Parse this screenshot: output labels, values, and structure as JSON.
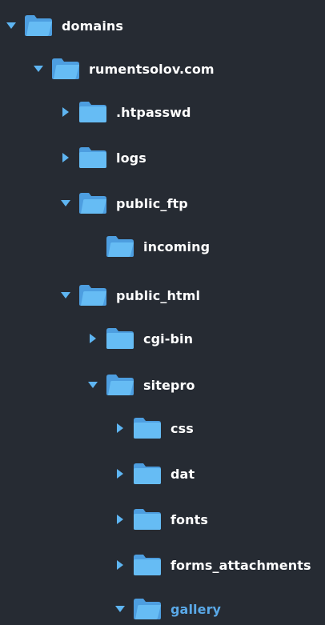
{
  "accent_color": "#5aa9e8",
  "folder_color": "#5eb5f2",
  "tree": {
    "nodes": [
      {
        "label": "domains",
        "state": "expanded"
      },
      {
        "label": "rumentsolov.com",
        "state": "expanded"
      },
      {
        "label": ".htpasswd",
        "state": "collapsed"
      },
      {
        "label": "logs",
        "state": "collapsed"
      },
      {
        "label": "public_ftp",
        "state": "expanded"
      },
      {
        "label": "incoming",
        "state": "leaf"
      },
      {
        "label": "public_html",
        "state": "expanded"
      },
      {
        "label": "cgi-bin",
        "state": "collapsed"
      },
      {
        "label": "sitepro",
        "state": "expanded"
      },
      {
        "label": "css",
        "state": "collapsed"
      },
      {
        "label": "dat",
        "state": "collapsed"
      },
      {
        "label": "fonts",
        "state": "collapsed"
      },
      {
        "label": "forms_attachments",
        "state": "collapsed"
      },
      {
        "label": "gallery",
        "state": "expanded",
        "active": true
      }
    ]
  }
}
